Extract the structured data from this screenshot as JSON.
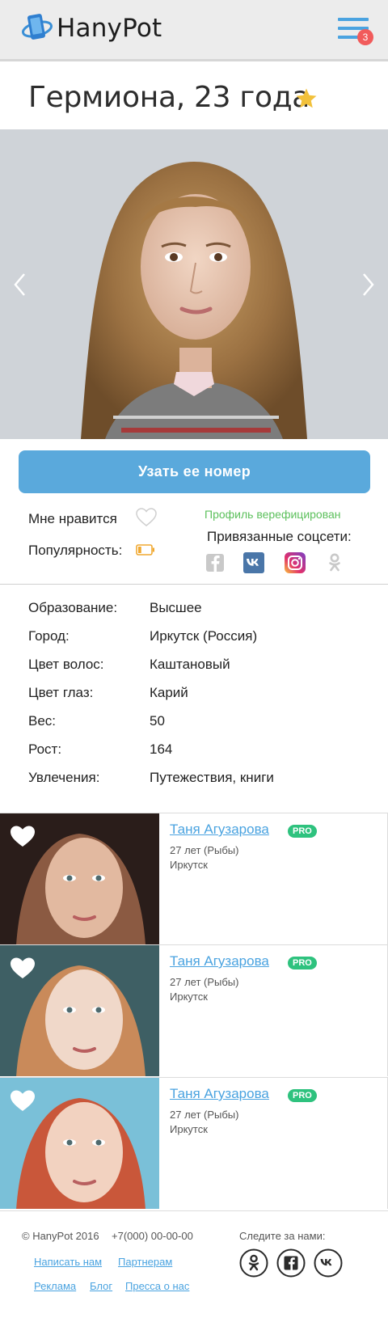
{
  "header": {
    "brand": "HanyPot",
    "menu_badge": "3"
  },
  "profile": {
    "title": "Гермиона, 23 года",
    "cta_label": "Узать ее номер",
    "like_label": "Мне нравится",
    "popularity_label": "Популярность:",
    "popularity_level": 0.25,
    "verified_text": "Профиль верефицирован",
    "socials_title": "Привязанные соцсети:",
    "socials": [
      "facebook-icon",
      "vk-icon",
      "instagram-icon",
      "odnoklassniki-icon"
    ]
  },
  "info": {
    "rows": [
      {
        "key": "Образование:",
        "value": "Высшее"
      },
      {
        "key": "Город:",
        "value": "Иркутск (Россия)"
      },
      {
        "key": "Цвет волос:",
        "value": "Каштановый"
      },
      {
        "key": "Цвет глаз:",
        "value": "Карий"
      },
      {
        "key": "Вес:",
        "value": "50"
      },
      {
        "key": "Рост:",
        "value": "164"
      },
      {
        "key": "Увлечения:",
        "value": "Путежествия, книги"
      }
    ]
  },
  "cards": [
    {
      "name": "Таня Агузарова",
      "badge": "PRO",
      "age": "27 лет (Рыбы)",
      "city": "Иркутск"
    },
    {
      "name": "Таня Агузарова",
      "badge": "PRO",
      "age": "27 лет (Рыбы)",
      "city": "Иркутск"
    },
    {
      "name": "Таня Агузарова",
      "badge": "PRO",
      "age": "27 лет (Рыбы)",
      "city": "Иркутск"
    }
  ],
  "footer": {
    "copyright": "© HanyPot 2016",
    "phone": "+7(000) 00-00-00",
    "follow": "Следите за нами:",
    "links": [
      "Написать нам",
      "Партнерам",
      "Реклама",
      "Блог",
      "Пресса о нас"
    ]
  },
  "colors": {
    "accent": "#4aa3e0",
    "cta": "#5aa9dc",
    "badge": "#f15b5b",
    "verified": "#5cc05c",
    "pro": "#2ec27e"
  }
}
